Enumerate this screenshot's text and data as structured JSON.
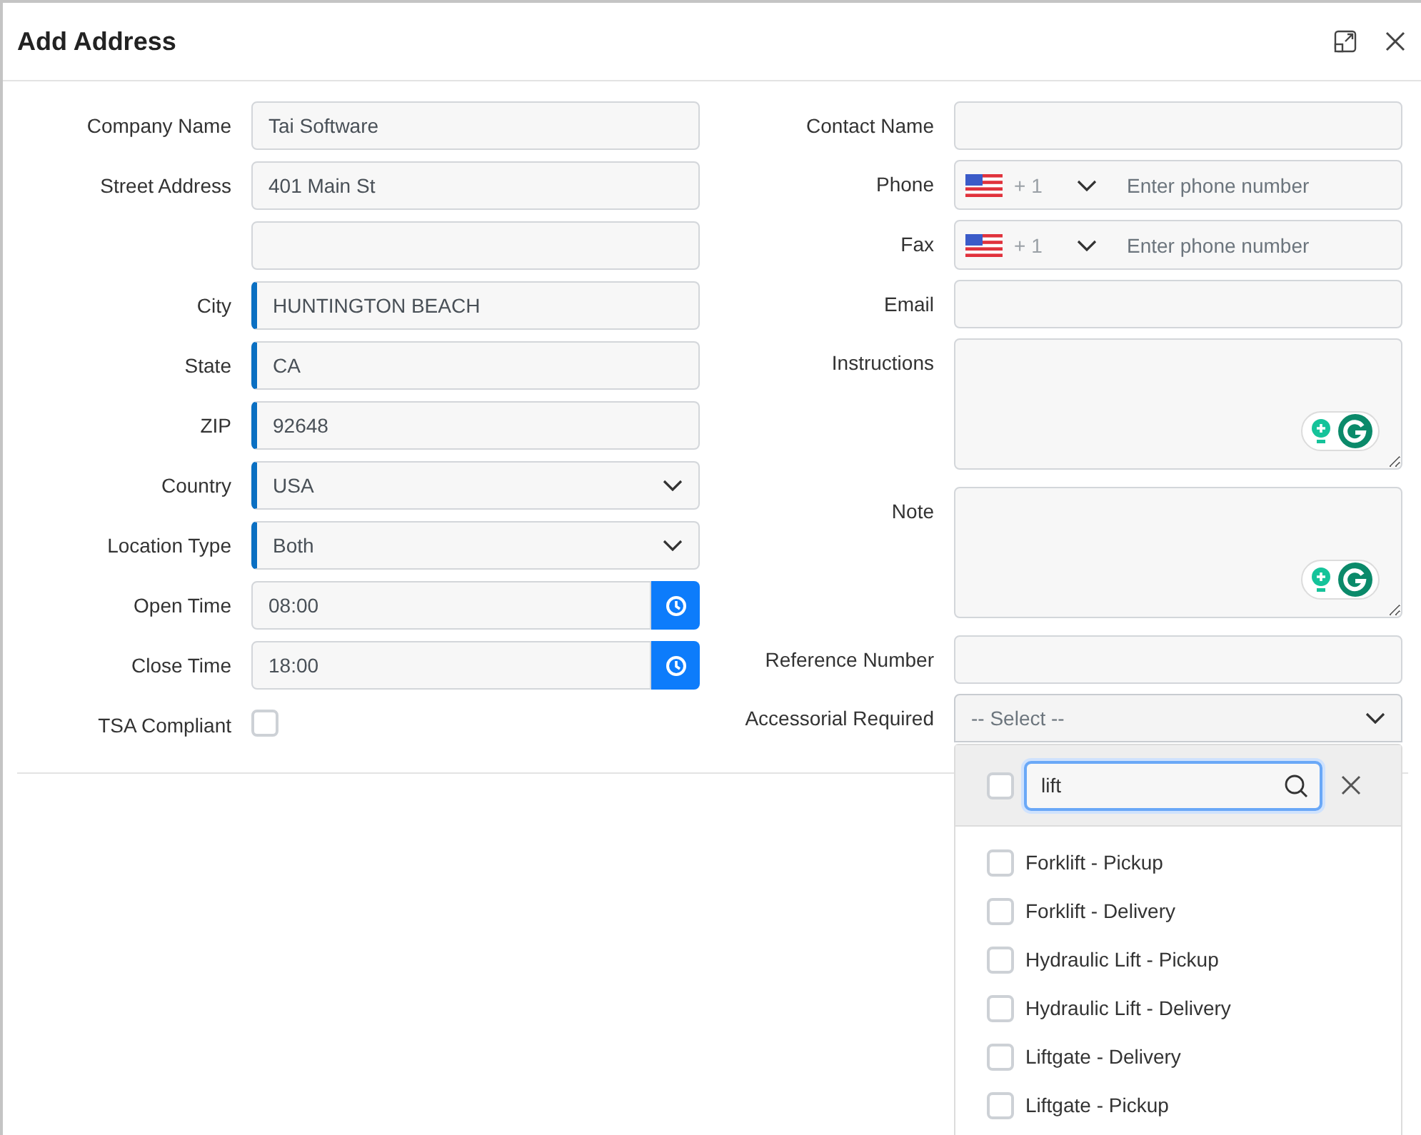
{
  "dialog": {
    "title": "Add Address"
  },
  "left_fields": [
    {
      "kind": "text",
      "label": "Company Name",
      "value": "Tai Software",
      "required": false
    },
    {
      "kind": "text",
      "label": "Street Address",
      "value": "401 Main St",
      "required": false
    },
    {
      "kind": "text",
      "required": false
    },
    {
      "kind": "text",
      "label": "City",
      "value": "HUNTINGTON BEACH",
      "required": true
    },
    {
      "kind": "text",
      "label": "State",
      "value": "CA",
      "required": true
    },
    {
      "kind": "text",
      "label": "ZIP",
      "value": "92648",
      "required": true
    },
    {
      "kind": "select",
      "label": "Country",
      "value": "USA",
      "required": true
    },
    {
      "kind": "select",
      "label": "Location Type",
      "value": "Both",
      "required": true
    },
    {
      "kind": "time",
      "label": "Open Time",
      "value": "08:00"
    },
    {
      "kind": "time",
      "label": "Close Time",
      "value": "18:00"
    },
    {
      "kind": "checkbox",
      "label": "TSA Compliant",
      "checked": false
    }
  ],
  "right_fields": [
    {
      "kind": "text",
      "label": "Contact Name",
      "required": false
    },
    {
      "kind": "phone",
      "label": "Phone",
      "code": "+ 1",
      "placeholder": "Enter phone number"
    },
    {
      "kind": "phone",
      "label": "Fax",
      "code": "+ 1",
      "placeholder": "Enter phone number"
    },
    {
      "kind": "text",
      "label": "Email",
      "required": false
    },
    {
      "kind": "textarea",
      "label": "Instructions"
    },
    {
      "kind": "textarea",
      "label": "Note"
    },
    {
      "kind": "text",
      "label": "Reference Number",
      "required": false
    },
    {
      "kind": "multiselect",
      "label": "Accessorial Required",
      "placeholder": "-- Select --",
      "expanded": true,
      "dropdown": {
        "select_all_checked": false,
        "search": "lift",
        "options": [
          {
            "label": "Forklift - Pickup",
            "checked": false
          },
          {
            "label": "Forklift - Delivery",
            "checked": false
          },
          {
            "label": "Hydraulic Lift - Pickup",
            "checked": false
          },
          {
            "label": "Hydraulic Lift - Delivery",
            "checked": false
          },
          {
            "label": "Liftgate - Delivery",
            "checked": false
          },
          {
            "label": "Liftgate - Pickup",
            "checked": false
          }
        ]
      }
    }
  ]
}
